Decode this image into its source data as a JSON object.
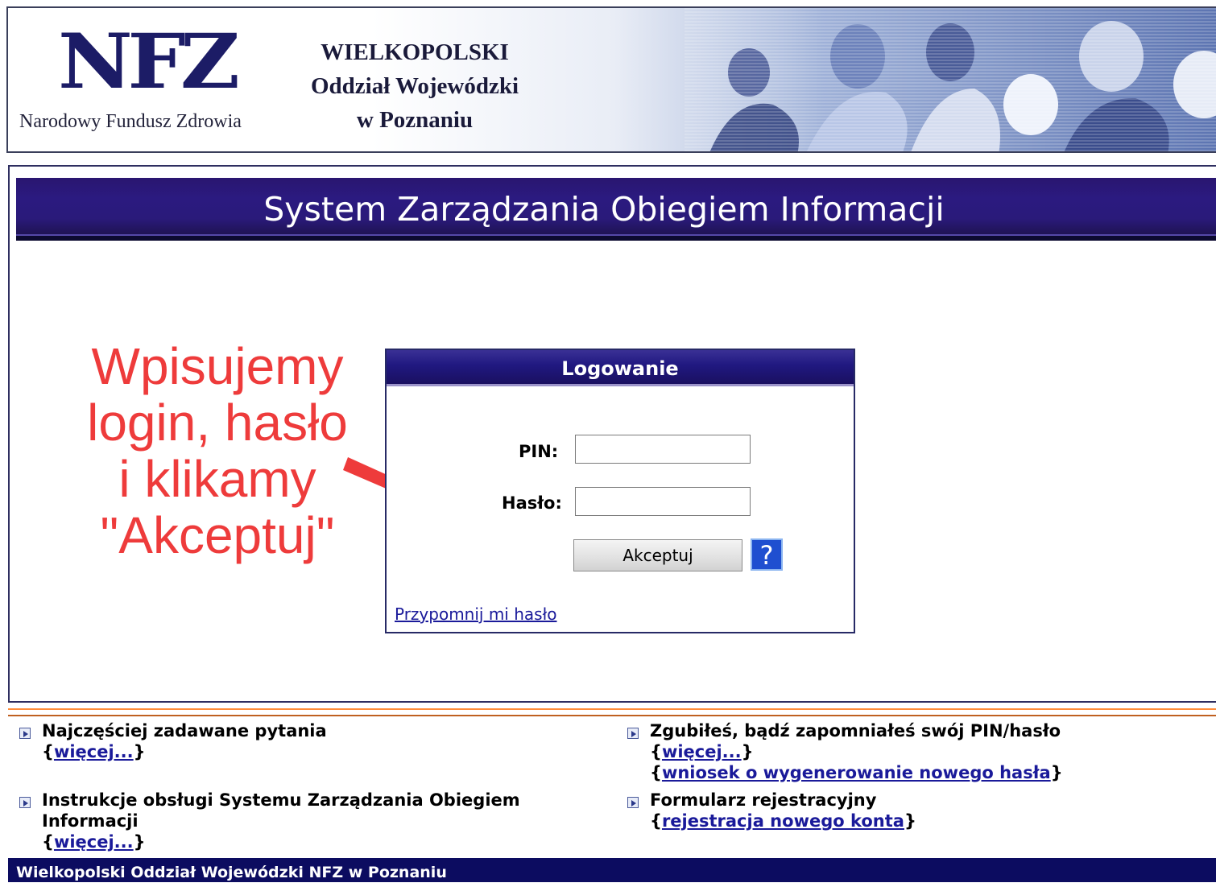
{
  "header": {
    "logo_text": "NFZ",
    "logo_subtitle": "Narodowy Fundusz Zdrowia",
    "branch_line1": "WIELKOPOLSKI",
    "branch_line2": "Oddział Wojewódzki",
    "branch_line3": "w Poznaniu"
  },
  "title_bar": {
    "title": "System Zarządzania Obiegiem Informacji"
  },
  "login": {
    "header": "Logowanie",
    "pin_label": "PIN:",
    "password_label": "Hasło:",
    "pin_value": "",
    "password_value": "",
    "accept_label": "Akceptuj",
    "help_label": "?",
    "remind_link": "Przypomnij mi hasło"
  },
  "annotation": {
    "text": "Wpisujemy\nlogin, hasło\ni klikamy\n\"Akceptuj\"",
    "color": "#ee3b3b"
  },
  "info": {
    "faq_title": "Najczęściej zadawane pytania",
    "faq_more": "więcej...",
    "manual_title_1": "Instrukcje obsługi Systemu Zarządzania Obiegiem",
    "manual_title_2": "Informacji",
    "manual_more": "więcej...",
    "lost_title": "Zgubiłeś, bądź zapomniałeś swój PIN/hasło",
    "lost_more": "więcej...",
    "lost_request": "wniosek o wygenerowanie nowego hasła",
    "register_title": "Formularz rejestracyjny",
    "register_link": "rejestracja nowego konta"
  },
  "footer": {
    "text": "Wielkopolski Oddział Wojewódzki NFZ w Poznaniu"
  },
  "colors": {
    "accent_dark_blue": "#1c1c66",
    "title_bar": "#2b1a80",
    "link": "#1a1a9a",
    "orange_rule": "#ff8c3a",
    "help_button": "#1f4fd0"
  }
}
